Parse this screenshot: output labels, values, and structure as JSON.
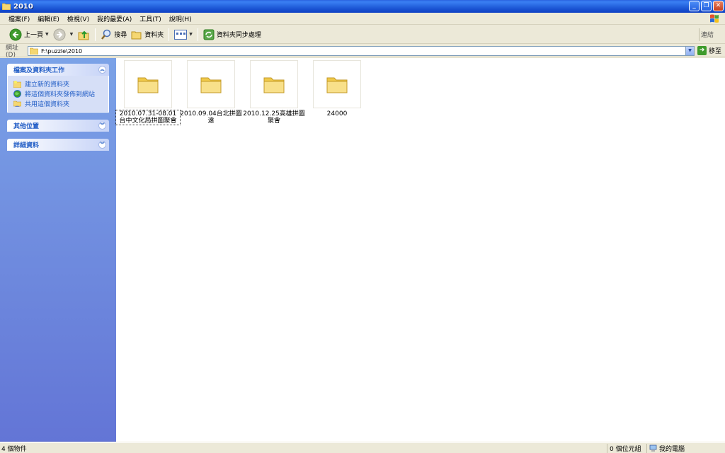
{
  "window": {
    "title": "2010"
  },
  "menu": [
    "檔案(F)",
    "編輯(E)",
    "檢視(V)",
    "我的最愛(A)",
    "工具(T)",
    "說明(H)"
  ],
  "toolbar": {
    "back_label": "上一頁",
    "search_label": "搜尋",
    "folders_label": "資料夾",
    "sync_label": "資料夾同步處理",
    "links_label": "連結"
  },
  "address": {
    "label": "網址(D)",
    "value": "F:\\puzzle\\2010",
    "go_label": "移至"
  },
  "taskpane": {
    "file_tasks": {
      "title": "檔案及資料夾工作",
      "items": [
        "建立新的資料夾",
        "將這個資料夾發佈到網站",
        "共用這個資料夾"
      ]
    },
    "other_places": {
      "title": "其他位置"
    },
    "details": {
      "title": "詳細資料"
    }
  },
  "folders": [
    {
      "name": "2010.07.31-08.01台中文化局拼圖聚會"
    },
    {
      "name": "2010.09.04台北拼圖遠"
    },
    {
      "name": "2010.12.25高雄拼圖聚會"
    },
    {
      "name": "24000"
    }
  ],
  "status": {
    "objects": "4 個物件",
    "size": "0 個位元組",
    "location": "我的電腦"
  },
  "colors": {
    "titlebar": "#0d3fc2",
    "taskpane": "#6375d6",
    "task_link": "#215dc6",
    "folder_yellow": "#f5d772"
  }
}
